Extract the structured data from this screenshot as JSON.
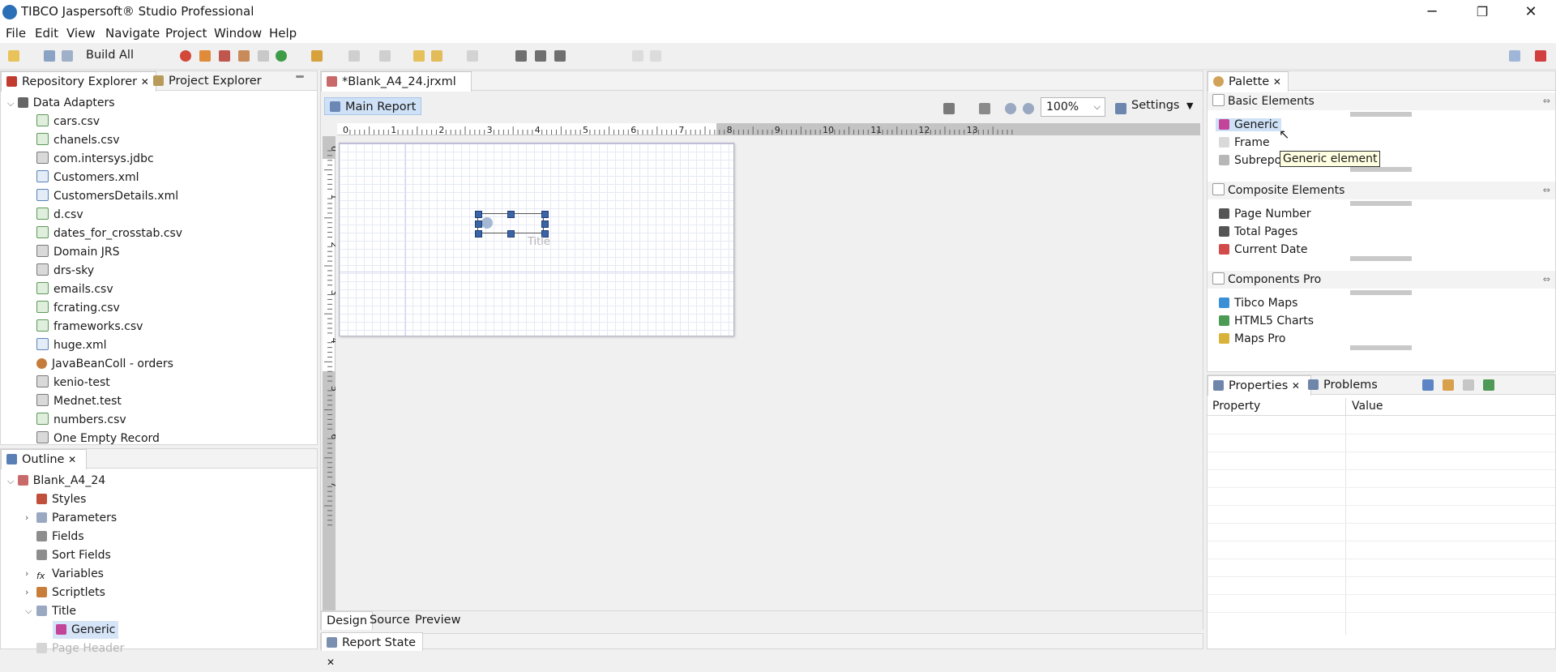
{
  "window": {
    "title": "TIBCO Jaspersoft® Studio Professional",
    "minimize": "─",
    "maximize": "❐",
    "close": "✕"
  },
  "menu": [
    "File",
    "Edit",
    "View",
    "Navigate",
    "Project",
    "Window",
    "Help"
  ],
  "toolbar": {
    "build_all": "Build All"
  },
  "left_top": {
    "tabs": [
      "Repository Explorer",
      "Project Explorer"
    ],
    "root": "Data Adapters",
    "items": [
      "cars.csv",
      "chanels.csv",
      "com.intersys.jdbc",
      "Customers.xml",
      "CustomersDetails.xml",
      "d.csv",
      "dates_for_crosstab.csv",
      "Domain JRS",
      "drs-sky",
      "emails.csv",
      "fcrating.csv",
      "frameworks.csv",
      "huge.xml",
      "JavaBeanColl - orders",
      "kenio-test",
      "Mednet.test",
      "numbers.csv",
      "One Empty Record"
    ]
  },
  "outline": {
    "tab": "Outline",
    "root": "Blank_A4_24",
    "items": [
      "Styles",
      "Parameters",
      "Fields",
      "Sort Fields",
      "Variables",
      "Scriptlets",
      "Title",
      "Generic",
      "Page Header"
    ]
  },
  "editor": {
    "tab": "*Blank_A4_24.jrxml",
    "main_report": "Main Report",
    "zoom": "100%",
    "settings": "Settings",
    "ruler": [
      "0",
      "1",
      "2",
      "3",
      "4",
      "5",
      "6",
      "7",
      "8",
      "9",
      "10",
      "11",
      "12",
      "13"
    ],
    "vruler": [
      "0",
      "1",
      "2",
      "3",
      "4",
      "5",
      "6",
      "7"
    ],
    "band_label": "Title",
    "bottom_tabs": [
      "Design",
      "Source",
      "Preview"
    ],
    "report_state": "Report State"
  },
  "palette": {
    "tab": "Palette",
    "sections": [
      {
        "name": "Basic Elements",
        "items": [
          "Generic",
          "Frame",
          "Subreport"
        ]
      },
      {
        "name": "Composite Elements",
        "items": [
          "Page Number",
          "Total Pages",
          "Current Date"
        ]
      },
      {
        "name": "Components Pro",
        "items": [
          "Tibco Maps",
          "HTML5 Charts",
          "Maps Pro"
        ]
      }
    ],
    "tooltip": "Generic element"
  },
  "properties": {
    "tabs": [
      "Properties",
      "Problems"
    ],
    "col_property": "Property",
    "col_value": "Value"
  }
}
